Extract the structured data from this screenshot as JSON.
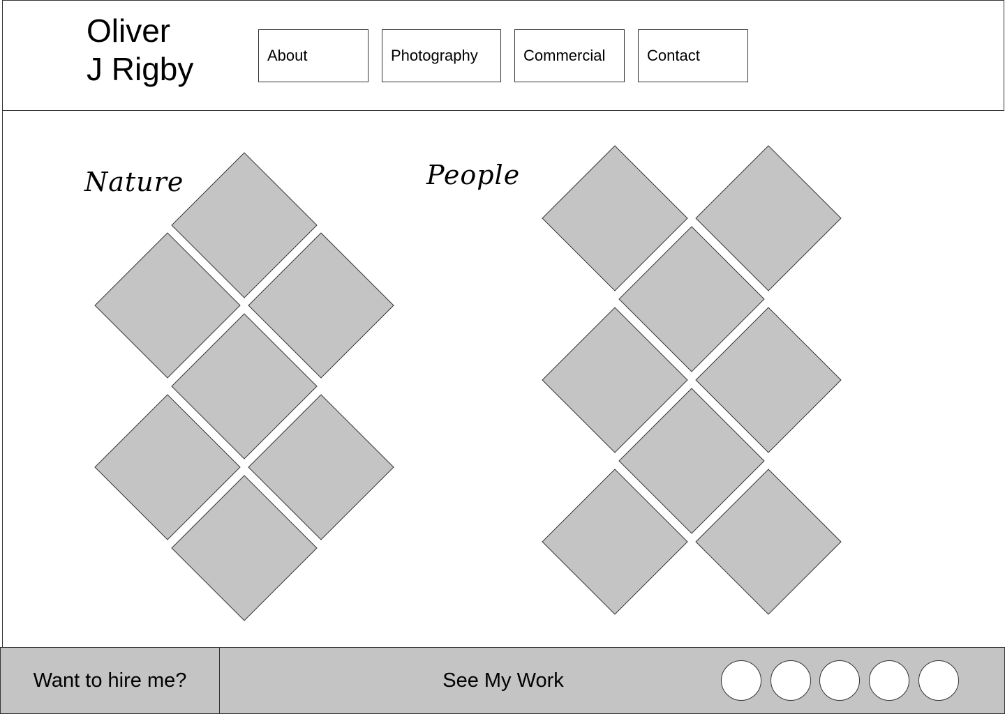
{
  "header": {
    "logo": "Oliver\nJ Rigby",
    "nav": [
      {
        "label": "About"
      },
      {
        "label": "Photography"
      },
      {
        "label": "Commercial"
      },
      {
        "label": "Contact"
      }
    ]
  },
  "main": {
    "nature_title": "Nature",
    "people_title": "People"
  },
  "footer": {
    "hire_label": "Want to hire me?",
    "see_work_label": "See My Work"
  },
  "colors": {
    "tile_fill": "#c4c4c4",
    "footer_bg": "#c4c4c4",
    "border": "#333333"
  }
}
